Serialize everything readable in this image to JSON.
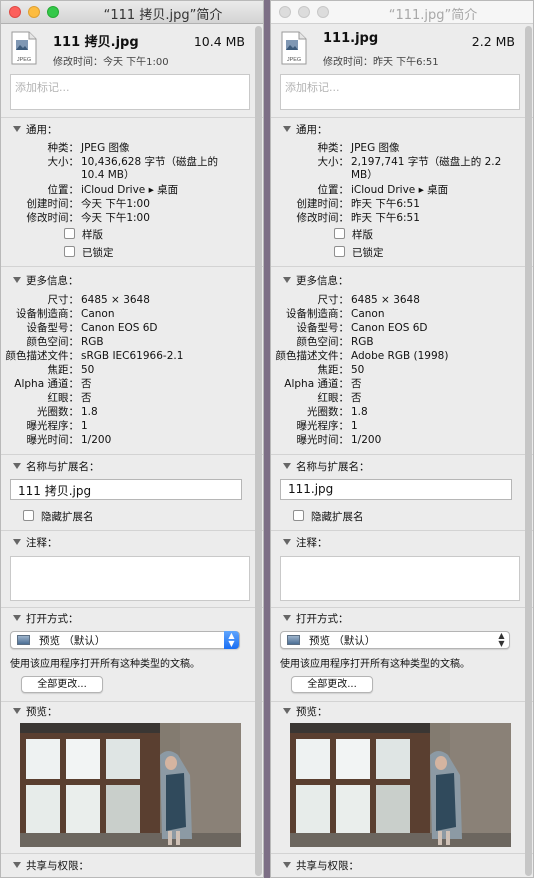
{
  "windows": [
    {
      "title": "“111 拷贝.jpg”简介",
      "header": {
        "file_name": "111 拷贝.jpg",
        "file_size": "10.4 MB",
        "modified": "修改时间：今天 下午1:00",
        "file_type_label": "JPEG"
      },
      "tags_placeholder": "添加标记...",
      "general": {
        "heading": "通用：",
        "rows": [
          {
            "key": "种类：",
            "value": "JPEG 图像"
          },
          {
            "key": "大小：",
            "value": "10,436,628 字节（磁盘上的 10.4 MB）"
          },
          {
            "key": "位置：",
            "value": "iCloud Drive ▸ 桌面"
          },
          {
            "key": "创建时间：",
            "value": "今天 下午1:00"
          },
          {
            "key": "修改时间：",
            "value": "今天 下午1:00"
          }
        ],
        "stationery": "样版",
        "locked": "已锁定"
      },
      "more_info": {
        "heading": "更多信息：",
        "rows": [
          {
            "key": "尺寸：",
            "value": "6485 × 3648"
          },
          {
            "key": "设备制造商：",
            "value": "Canon"
          },
          {
            "key": "设备型号：",
            "value": "Canon EOS 6D"
          },
          {
            "key": "颜色空间：",
            "value": "RGB"
          },
          {
            "key": "颜色描述文件：",
            "value": "sRGB IEC61966-2.1"
          },
          {
            "key": "焦距：",
            "value": "50"
          },
          {
            "key": "Alpha 通道：",
            "value": "否"
          },
          {
            "key": "红眼：",
            "value": "否"
          },
          {
            "key": "光圈数：",
            "value": "1.8"
          },
          {
            "key": "曝光程序：",
            "value": "1"
          },
          {
            "key": "曝光时间：",
            "value": "1/200"
          }
        ]
      },
      "name_ext": {
        "heading": "名称与扩展名：",
        "value": "111 拷贝.jpg",
        "hide_ext": "隐藏扩展名"
      },
      "comments": {
        "heading": "注释："
      },
      "open_with": {
        "heading": "打开方式：",
        "app": "预览 （默认）",
        "description": "使用该应用程序打开所有这种类型的文稿。",
        "change_all": "全部更改..."
      },
      "preview": {
        "heading": "预览："
      },
      "sharing": {
        "heading": "共享与权限："
      }
    },
    {
      "title": "“111.jpg”简介",
      "header": {
        "file_name": "111.jpg",
        "file_size": "2.2 MB",
        "modified": "修改时间：昨天 下午6:51",
        "file_type_label": "JPEG"
      },
      "tags_placeholder": "添加标记...",
      "general": {
        "heading": "通用：",
        "rows": [
          {
            "key": "种类：",
            "value": "JPEG 图像"
          },
          {
            "key": "大小：",
            "value": "2,197,741 字节（磁盘上的 2.2 MB）"
          },
          {
            "key": "位置：",
            "value": "iCloud Drive ▸ 桌面"
          },
          {
            "key": "创建时间：",
            "value": "昨天 下午6:51"
          },
          {
            "key": "修改时间：",
            "value": "昨天 下午6:51"
          }
        ],
        "stationery": "样版",
        "locked": "已锁定"
      },
      "more_info": {
        "heading": "更多信息：",
        "rows": [
          {
            "key": "尺寸：",
            "value": "6485 × 3648"
          },
          {
            "key": "设备制造商：",
            "value": "Canon"
          },
          {
            "key": "设备型号：",
            "value": "Canon EOS 6D"
          },
          {
            "key": "颜色空间：",
            "value": "RGB"
          },
          {
            "key": "颜色描述文件：",
            "value": "Adobe RGB (1998)"
          },
          {
            "key": "焦距：",
            "value": "50"
          },
          {
            "key": "Alpha 通道：",
            "value": "否"
          },
          {
            "key": "红眼：",
            "value": "否"
          },
          {
            "key": "光圈数：",
            "value": "1.8"
          },
          {
            "key": "曝光程序：",
            "value": "1"
          },
          {
            "key": "曝光时间：",
            "value": "1/200"
          }
        ]
      },
      "name_ext": {
        "heading": "名称与扩展名：",
        "value": "111.jpg",
        "hide_ext": "隐藏扩展名"
      },
      "comments": {
        "heading": "注释："
      },
      "open_with": {
        "heading": "打开方式：",
        "app": "预览 （默认）",
        "description": "使用该应用程序打开所有这种类型的文稿。",
        "change_all": "全部更改..."
      },
      "preview": {
        "heading": "预览："
      },
      "sharing": {
        "heading": "共享与权限："
      }
    }
  ],
  "colors": {
    "window_bg": "#ececec",
    "desktop_bg": "#7d6f86",
    "popup_accent": "#1a6ef3"
  }
}
